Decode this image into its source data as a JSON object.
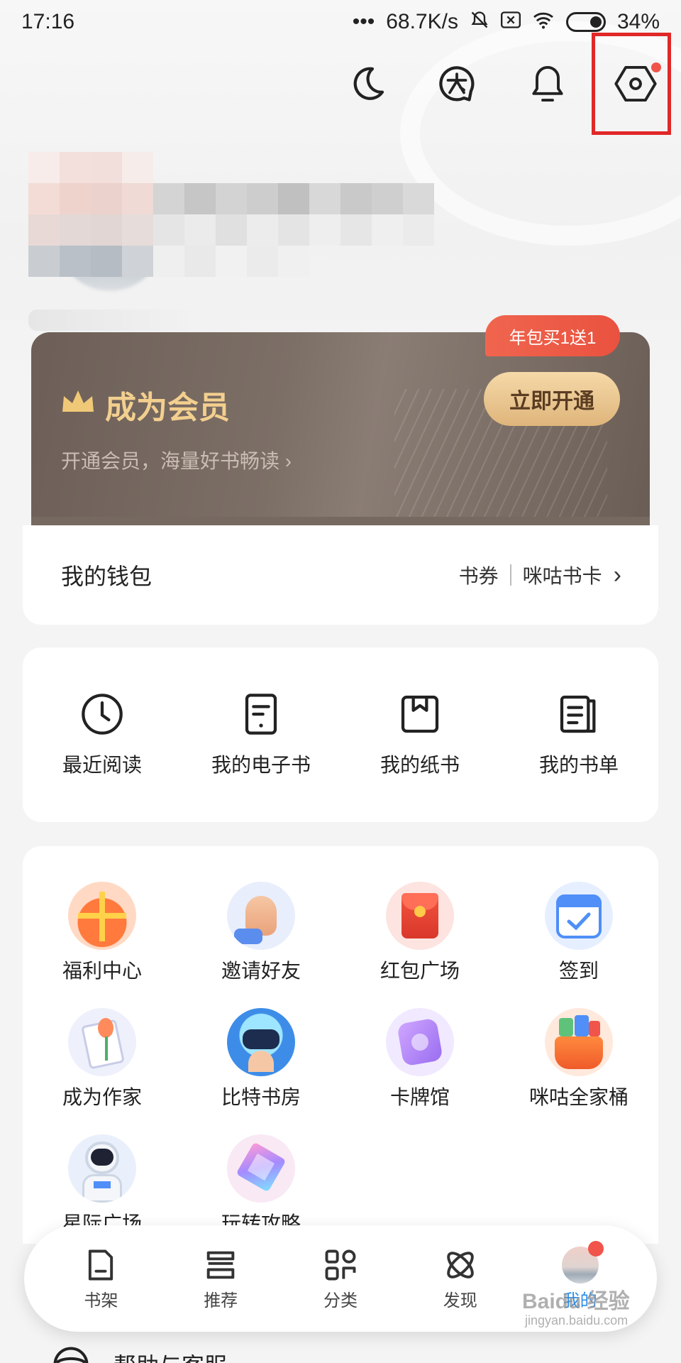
{
  "status_bar": {
    "time": "17:16",
    "dots": "•••",
    "net_speed": "68.7K/s",
    "battery": "34%"
  },
  "top_actions": {
    "icons": [
      "moon-icon",
      "translate-icon",
      "bell-icon",
      "settings-icon"
    ]
  },
  "member": {
    "title": "成为会员",
    "subtitle": "开通会员，海量好书畅读",
    "subtitle_arrow": "›",
    "open_button": "立即开通",
    "promo": "年包买1送1",
    "colors": {
      "card": "#756860",
      "gold": "#f3cf8f",
      "promo": "#ec5a45"
    }
  },
  "wallet": {
    "title": "我的钱包",
    "link1": "书券",
    "link2": "咪咕书卡",
    "arrow": "›"
  },
  "reading": {
    "items": [
      {
        "label": "最近阅读",
        "icon": "clock-icon"
      },
      {
        "label": "我的电子书",
        "icon": "ebook-icon"
      },
      {
        "label": "我的纸书",
        "icon": "paper-book-icon"
      },
      {
        "label": "我的书单",
        "icon": "booklist-icon"
      }
    ]
  },
  "services": {
    "items": [
      {
        "label": "福利中心",
        "icon": "gift-icon"
      },
      {
        "label": "邀请好友",
        "icon": "invite-hand-icon"
      },
      {
        "label": "红包广场",
        "icon": "red-envelope-icon"
      },
      {
        "label": "签到",
        "icon": "calendar-check-icon"
      },
      {
        "label": "成为作家",
        "icon": "writer-icon"
      },
      {
        "label": "比特书房",
        "icon": "bit-study-icon"
      },
      {
        "label": "卡牌馆",
        "icon": "card-hall-icon"
      },
      {
        "label": "咪咕全家桶",
        "icon": "migu-bucket-icon"
      },
      {
        "label": "星际广场",
        "icon": "astronaut-icon"
      },
      {
        "label": "玩转攻略",
        "icon": "crystal-icon"
      }
    ]
  },
  "bottom_nav": {
    "items": [
      {
        "label": "书架",
        "icon": "bookshelf-icon"
      },
      {
        "label": "推荐",
        "icon": "recommend-icon"
      },
      {
        "label": "分类",
        "icon": "category-icon"
      },
      {
        "label": "发现",
        "icon": "discover-icon"
      },
      {
        "label": "我的",
        "icon": "avatar-icon"
      }
    ],
    "active_color": "#2c8de8"
  },
  "help": {
    "label": "帮助与客服"
  },
  "watermark": {
    "text": "Baidu 经验",
    "url": "jingyan.baidu.com"
  }
}
